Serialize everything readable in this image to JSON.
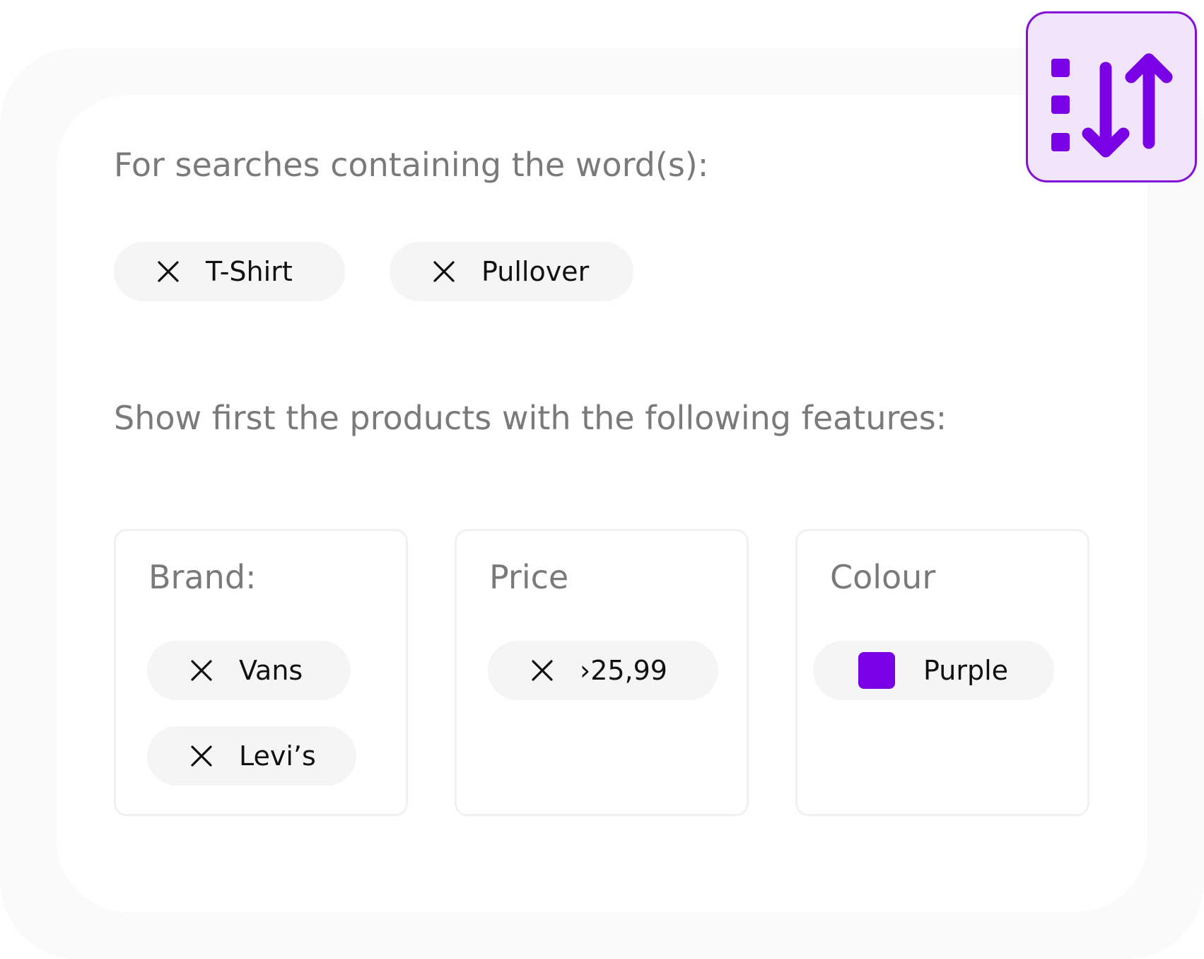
{
  "colors": {
    "accent": "#7a00e6",
    "badge_background": "#f0e5fa",
    "heading_text": "#7a7a7a",
    "chip_background": "#f5f5f5"
  },
  "header": {
    "sort_badge_icon": "sort-order-icon"
  },
  "search_terms": {
    "heading": "For searches containing the word(s):",
    "terms": [
      {
        "label": "T-Shirt",
        "remove_icon": "close-icon"
      },
      {
        "label": "Pullover",
        "remove_icon": "close-icon"
      }
    ]
  },
  "features": {
    "heading": "Show first the products with the following features:",
    "cards": [
      {
        "title": "Brand:",
        "chips": [
          {
            "label": "Vans",
            "remove_icon": "close-icon"
          },
          {
            "label": "Levi’s",
            "remove_icon": "close-icon"
          }
        ]
      },
      {
        "title": "Price",
        "chips": [
          {
            "label": "›25,99",
            "remove_icon": "close-icon"
          }
        ]
      },
      {
        "title": "Colour",
        "chips": [
          {
            "label": "Purple",
            "swatch_color": "#7a00e6"
          }
        ]
      }
    ]
  }
}
